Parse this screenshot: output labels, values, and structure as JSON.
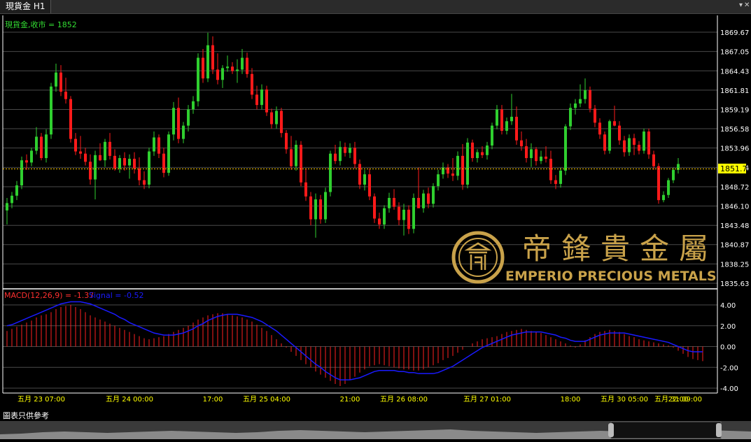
{
  "tab": {
    "title": "現貨金 H1"
  },
  "main_chart": {
    "series_label": "現貨金,收市 = 1852",
    "current_price": "1851.77",
    "price_ticks": [
      "1869.67",
      "1867.05",
      "1864.43",
      "1861.81",
      "1859.19",
      "1856.58",
      "1853.96",
      "1851.34",
      "1848.72",
      "1846.10",
      "1843.48",
      "1840.87",
      "1838.25",
      "1835.63"
    ]
  },
  "macd": {
    "label_macd": "MACD(12,26,9) = -1.37",
    "label_signal": "Signal = -0.52",
    "ticks": [
      "4.00",
      "2.00",
      "0.00",
      "-2.00",
      "-4.00"
    ]
  },
  "time_axis": [
    "五月 23 07:00",
    "五月 24 00:00",
    "17:00",
    "五月 25 04:00",
    "21:00",
    "五月 26 08:00",
    "五月 27 01:00",
    "18:00",
    "五月 30 05:00",
    "22:00",
    "五月 31 09:00"
  ],
  "watermark": {
    "chinese": "帝鋒貴金屬",
    "english": "EMPERIO PRECIOUS METALS"
  },
  "footer": {
    "note": "圖表只供參考"
  },
  "colors": {
    "up": "#2fcf2f",
    "down": "#ff1a1a",
    "macd_hist": "#ff2020",
    "signal": "#1a1aff",
    "grid": "#4a4a4a",
    "axis_text": "#ffffff",
    "time_text": "#ffff00",
    "label_green": "#33dd33",
    "price_line": "#ffcc00",
    "gold": "#c9a24a"
  },
  "chart_data": {
    "type": "candlestick",
    "title": "現貨金 H1",
    "timeframe": "H1",
    "ylim": [
      1835.63,
      1870.9
    ],
    "macd_ylim": [
      -4.0,
      5.0
    ],
    "grid": true,
    "x_tick_labels": [
      "五月 23 07:00",
      "五月 24 00:00",
      "17:00",
      "五月 25 04:00",
      "21:00",
      "五月 26 08:00",
      "五月 27 01:00",
      "18:00",
      "五月 30 05:00",
      "22:00",
      "五月 31 09:00"
    ],
    "ohlc": [
      [
        1845.5,
        1847.2,
        1843.6,
        1846.5
      ],
      [
        1846.5,
        1848.0,
        1845.8,
        1847.5
      ],
      [
        1847.5,
        1849.5,
        1846.9,
        1848.9
      ],
      [
        1848.9,
        1852.8,
        1848.4,
        1852.3
      ],
      [
        1852.3,
        1853.1,
        1851.0,
        1852.0
      ],
      [
        1852.0,
        1854.0,
        1851.5,
        1853.6
      ],
      [
        1853.6,
        1856.8,
        1853.1,
        1855.5
      ],
      [
        1855.5,
        1856.0,
        1852.3,
        1852.6
      ],
      [
        1852.6,
        1856.5,
        1852.0,
        1855.8
      ],
      [
        1855.8,
        1862.8,
        1855.2,
        1862.3
      ],
      [
        1862.3,
        1865.4,
        1861.6,
        1864.2
      ],
      [
        1864.2,
        1865.2,
        1861.0,
        1861.6
      ],
      [
        1861.6,
        1863.5,
        1860.0,
        1860.6
      ],
      [
        1860.6,
        1861.0,
        1854.7,
        1855.2
      ],
      [
        1855.2,
        1856.0,
        1853.0,
        1853.5
      ],
      [
        1853.5,
        1855.6,
        1852.5,
        1853.2
      ],
      [
        1853.2,
        1854.0,
        1851.6,
        1852.1
      ],
      [
        1852.1,
        1853.1,
        1849.0,
        1849.7
      ],
      [
        1849.7,
        1853.6,
        1847.0,
        1853.0
      ],
      [
        1853.0,
        1854.6,
        1852.2,
        1852.3
      ],
      [
        1852.3,
        1855.2,
        1851.4,
        1854.8
      ],
      [
        1854.8,
        1856.0,
        1852.4,
        1852.9
      ],
      [
        1852.9,
        1853.8,
        1850.9,
        1851.2
      ],
      [
        1851.2,
        1853.0,
        1850.6,
        1852.6
      ],
      [
        1852.6,
        1853.4,
        1850.9,
        1851.6
      ],
      [
        1851.6,
        1853.1,
        1849.8,
        1852.5
      ],
      [
        1852.5,
        1853.4,
        1850.5,
        1851.2
      ],
      [
        1851.2,
        1852.7,
        1848.9,
        1849.6
      ],
      [
        1849.6,
        1850.8,
        1848.4,
        1849.0
      ],
      [
        1849.0,
        1854.0,
        1848.5,
        1853.5
      ],
      [
        1853.5,
        1856.2,
        1852.9,
        1855.4
      ],
      [
        1855.4,
        1855.8,
        1852.6,
        1853.2
      ],
      [
        1853.2,
        1854.0,
        1850.0,
        1850.6
      ],
      [
        1850.6,
        1856.2,
        1850.2,
        1855.8
      ],
      [
        1855.8,
        1860.2,
        1855.0,
        1859.4
      ],
      [
        1859.4,
        1860.8,
        1854.6,
        1855.2
      ],
      [
        1855.2,
        1857.5,
        1854.6,
        1857.0
      ],
      [
        1857.0,
        1859.8,
        1856.2,
        1859.2
      ],
      [
        1859.2,
        1861.0,
        1858.6,
        1860.3
      ],
      [
        1860.3,
        1866.8,
        1859.6,
        1866.2
      ],
      [
        1866.2,
        1867.4,
        1862.8,
        1863.4
      ],
      [
        1863.4,
        1869.6,
        1862.9,
        1867.9
      ],
      [
        1867.9,
        1869.1,
        1864.0,
        1864.6
      ],
      [
        1864.6,
        1866.8,
        1862.6,
        1863.2
      ],
      [
        1863.2,
        1865.2,
        1862.1,
        1864.8
      ],
      [
        1864.8,
        1866.5,
        1864.3,
        1865.0
      ],
      [
        1865.0,
        1865.6,
        1864.0,
        1864.4
      ],
      [
        1864.4,
        1866.0,
        1862.8,
        1864.6
      ],
      [
        1864.6,
        1867.4,
        1864.0,
        1866.2
      ],
      [
        1866.2,
        1866.9,
        1863.5,
        1864.0
      ],
      [
        1864.0,
        1864.8,
        1860.6,
        1861.2
      ],
      [
        1861.2,
        1862.4,
        1859.2,
        1859.8
      ],
      [
        1859.8,
        1862.6,
        1859.2,
        1861.9
      ],
      [
        1861.9,
        1862.4,
        1858.3,
        1858.8
      ],
      [
        1858.8,
        1859.3,
        1856.6,
        1857.2
      ],
      [
        1857.2,
        1859.6,
        1856.6,
        1859.0
      ],
      [
        1859.0,
        1859.4,
        1855.4,
        1856.0
      ],
      [
        1856.0,
        1856.4,
        1853.2,
        1853.8
      ],
      [
        1853.8,
        1855.6,
        1851.0,
        1851.5
      ],
      [
        1851.5,
        1855.0,
        1850.9,
        1854.4
      ],
      [
        1854.4,
        1854.9,
        1848.8,
        1849.3
      ],
      [
        1849.3,
        1851.2,
        1846.8,
        1847.4
      ],
      [
        1847.4,
        1848.0,
        1843.5,
        1844.3
      ],
      [
        1844.3,
        1847.8,
        1841.8,
        1847.0
      ],
      [
        1847.0,
        1847.6,
        1843.7,
        1844.3
      ],
      [
        1844.3,
        1848.6,
        1843.8,
        1848.0
      ],
      [
        1848.0,
        1853.6,
        1847.4,
        1853.2
      ],
      [
        1853.2,
        1854.4,
        1851.8,
        1852.2
      ],
      [
        1852.2,
        1854.9,
        1851.6,
        1854.1
      ],
      [
        1854.1,
        1854.7,
        1852.8,
        1853.3
      ],
      [
        1853.3,
        1854.6,
        1852.6,
        1854.0
      ],
      [
        1854.0,
        1854.8,
        1851.2,
        1851.8
      ],
      [
        1851.8,
        1852.4,
        1848.4,
        1849.0
      ],
      [
        1849.0,
        1851.0,
        1848.2,
        1850.4
      ],
      [
        1850.4,
        1851.2,
        1846.9,
        1847.4
      ],
      [
        1847.4,
        1847.8,
        1843.8,
        1844.4
      ],
      [
        1844.4,
        1845.2,
        1843.0,
        1843.6
      ],
      [
        1843.6,
        1846.2,
        1843.0,
        1845.8
      ],
      [
        1845.8,
        1847.9,
        1845.2,
        1847.2
      ],
      [
        1847.2,
        1848.4,
        1845.6,
        1846.0
      ],
      [
        1846.0,
        1846.6,
        1843.5,
        1844.2
      ],
      [
        1844.2,
        1846.4,
        1842.1,
        1845.6
      ],
      [
        1845.6,
        1846.2,
        1842.3,
        1843.0
      ],
      [
        1843.0,
        1847.8,
        1842.4,
        1847.2
      ],
      [
        1847.2,
        1851.3,
        1846.7,
        1845.8
      ],
      [
        1845.8,
        1848.3,
        1845.2,
        1847.8
      ],
      [
        1847.8,
        1848.6,
        1845.8,
        1846.4
      ],
      [
        1846.4,
        1849.2,
        1845.9,
        1848.8
      ],
      [
        1848.8,
        1851.0,
        1848.2,
        1850.4
      ],
      [
        1850.4,
        1852.0,
        1849.8,
        1851.3
      ],
      [
        1851.3,
        1851.8,
        1849.9,
        1850.5
      ],
      [
        1850.5,
        1852.6,
        1849.5,
        1850.2
      ],
      [
        1850.2,
        1853.5,
        1849.6,
        1852.9
      ],
      [
        1852.9,
        1854.5,
        1848.3,
        1849.0
      ],
      [
        1849.0,
        1855.3,
        1848.5,
        1854.7
      ],
      [
        1854.7,
        1855.1,
        1852.1,
        1852.6
      ],
      [
        1852.6,
        1853.8,
        1852.0,
        1853.4
      ],
      [
        1853.4,
        1854.2,
        1852.6,
        1853.0
      ],
      [
        1853.0,
        1854.8,
        1852.4,
        1854.3
      ],
      [
        1854.3,
        1857.4,
        1853.8,
        1857.0
      ],
      [
        1857.0,
        1859.8,
        1856.5,
        1859.2
      ],
      [
        1859.2,
        1859.8,
        1855.8,
        1856.3
      ],
      [
        1856.3,
        1858.1,
        1855.8,
        1857.6
      ],
      [
        1857.6,
        1861.3,
        1857.1,
        1858.2
      ],
      [
        1858.2,
        1859.6,
        1854.4,
        1855.0
      ],
      [
        1855.0,
        1856.2,
        1853.6,
        1854.2
      ],
      [
        1854.2,
        1855.2,
        1852.0,
        1852.6
      ],
      [
        1852.6,
        1854.6,
        1851.4,
        1853.8
      ],
      [
        1853.8,
        1854.1,
        1851.6,
        1852.2
      ],
      [
        1852.2,
        1853.6,
        1851.8,
        1852.8
      ],
      [
        1852.8,
        1854.2,
        1852.0,
        1852.5
      ],
      [
        1852.5,
        1853.6,
        1849.1,
        1849.6
      ],
      [
        1849.6,
        1850.3,
        1848.4,
        1849.1
      ],
      [
        1849.1,
        1851.3,
        1848.6,
        1850.9
      ],
      [
        1850.9,
        1857.2,
        1850.3,
        1856.9
      ],
      [
        1856.9,
        1860.0,
        1856.4,
        1859.4
      ],
      [
        1859.4,
        1860.6,
        1858.5,
        1860.0
      ],
      [
        1860.0,
        1862.6,
        1859.5,
        1860.6
      ],
      [
        1860.6,
        1863.4,
        1860.0,
        1861.8
      ],
      [
        1861.8,
        1862.3,
        1858.8,
        1859.3
      ],
      [
        1859.3,
        1859.8,
        1856.8,
        1857.4
      ],
      [
        1857.4,
        1858.0,
        1855.2,
        1855.8
      ],
      [
        1855.8,
        1856.2,
        1853.1,
        1853.6
      ],
      [
        1853.6,
        1857.8,
        1853.2,
        1857.6
      ],
      [
        1857.6,
        1859.7,
        1856.9,
        1857.0
      ],
      [
        1857.0,
        1857.6,
        1854.4,
        1855.0
      ],
      [
        1855.0,
        1855.6,
        1852.8,
        1853.4
      ],
      [
        1853.4,
        1855.8,
        1852.9,
        1855.3
      ],
      [
        1855.3,
        1855.9,
        1853.0,
        1854.4
      ],
      [
        1854.4,
        1854.9,
        1853.1,
        1853.6
      ],
      [
        1853.6,
        1856.6,
        1853.2,
        1856.2
      ],
      [
        1856.2,
        1856.6,
        1852.5,
        1853.1
      ],
      [
        1853.1,
        1853.6,
        1851.0,
        1851.5
      ],
      [
        1851.5,
        1851.9,
        1846.4,
        1846.9
      ],
      [
        1846.9,
        1848.1,
        1846.6,
        1847.6
      ],
      [
        1847.6,
        1849.9,
        1847.2,
        1849.6
      ],
      [
        1849.6,
        1851.3,
        1849.2,
        1851.0
      ],
      [
        1851.0,
        1852.6,
        1850.5,
        1851.8
      ]
    ],
    "macd_histogram": [
      1.5,
      1.7,
      1.9,
      2.1,
      2.3,
      2.5,
      2.8,
      3.0,
      3.1,
      3.3,
      3.6,
      3.8,
      3.9,
      4.0,
      3.8,
      3.6,
      3.3,
      3.0,
      2.8,
      2.6,
      2.4,
      2.2,
      2.0,
      1.8,
      1.6,
      1.4,
      1.2,
      1.0,
      0.8,
      0.7,
      0.8,
      0.9,
      1.0,
      1.2,
      1.4,
      1.6,
      1.8,
      2.0,
      2.3,
      2.6,
      2.8,
      3.0,
      3.1,
      3.2,
      3.2,
      3.1,
      3.0,
      2.9,
      2.8,
      2.6,
      2.4,
      2.1,
      1.8,
      1.5,
      1.1,
      0.7,
      0.3,
      -0.1,
      -0.5,
      -0.9,
      -1.3,
      -1.7,
      -2.0,
      -2.4,
      -2.7,
      -3.0,
      -3.3,
      -3.6,
      -3.8,
      -3.6,
      -3.2,
      -2.9,
      -2.5,
      -2.2,
      -1.9,
      -1.8,
      -1.7,
      -1.8,
      -1.9,
      -2.0,
      -2.1,
      -2.2,
      -2.2,
      -2.3,
      -2.3,
      -2.2,
      -2.0,
      -1.8,
      -1.6,
      -1.3,
      -1.1,
      -0.9,
      -0.6,
      -0.3,
      0.0,
      0.3,
      0.5,
      0.7,
      0.8,
      0.9,
      1.0,
      1.2,
      1.4,
      1.5,
      1.6,
      1.7,
      1.6,
      1.5,
      1.4,
      1.3,
      1.1,
      0.9,
      0.7,
      0.5,
      0.3,
      0.1,
      -0.1,
      0.2,
      0.6,
      0.9,
      1.2,
      1.4,
      1.5,
      1.6,
      1.5,
      1.4,
      1.2,
      1.0,
      0.9,
      0.7,
      0.6,
      0.5,
      0.4,
      0.3,
      0.2,
      0.1,
      -0.1,
      -0.4,
      -0.7,
      -1.0,
      -1.2,
      -1.3,
      -1.4
    ],
    "signal": [
      2.0,
      2.1,
      2.3,
      2.5,
      2.7,
      2.9,
      3.1,
      3.3,
      3.5,
      3.7,
      3.9,
      4.1,
      4.2,
      4.3,
      4.3,
      4.3,
      4.2,
      4.1,
      3.9,
      3.7,
      3.5,
      3.3,
      3.1,
      2.8,
      2.6,
      2.3,
      2.1,
      1.9,
      1.7,
      1.5,
      1.3,
      1.2,
      1.1,
      1.1,
      1.1,
      1.2,
      1.3,
      1.5,
      1.7,
      2.0,
      2.2,
      2.5,
      2.7,
      2.9,
      3.0,
      3.1,
      3.1,
      3.1,
      3.0,
      2.9,
      2.8,
      2.6,
      2.4,
      2.1,
      1.8,
      1.5,
      1.1,
      0.7,
      0.3,
      -0.1,
      -0.5,
      -0.9,
      -1.3,
      -1.7,
      -2.0,
      -2.4,
      -2.7,
      -3.0,
      -3.2,
      -3.2,
      -3.2,
      -3.1,
      -3.0,
      -2.8,
      -2.6,
      -2.4,
      -2.3,
      -2.3,
      -2.3,
      -2.3,
      -2.4,
      -2.4,
      -2.5,
      -2.5,
      -2.6,
      -2.6,
      -2.6,
      -2.6,
      -2.5,
      -2.3,
      -2.1,
      -1.9,
      -1.6,
      -1.3,
      -1.0,
      -0.7,
      -0.4,
      -0.1,
      0.1,
      0.3,
      0.5,
      0.7,
      0.9,
      1.1,
      1.2,
      1.3,
      1.4,
      1.4,
      1.4,
      1.4,
      1.3,
      1.2,
      1.1,
      0.9,
      0.8,
      0.6,
      0.5,
      0.5,
      0.5,
      0.7,
      0.9,
      1.1,
      1.2,
      1.3,
      1.3,
      1.3,
      1.3,
      1.2,
      1.1,
      1.0,
      0.9,
      0.8,
      0.7,
      0.6,
      0.5,
      0.4,
      0.2,
      0.0,
      -0.2,
      -0.4,
      -0.5,
      -0.5,
      -0.5
    ],
    "navigator_profile": [
      0.35,
      0.4,
      0.5,
      0.55,
      0.5,
      0.45,
      0.5,
      0.55,
      0.6,
      0.55,
      0.5,
      0.45,
      0.5,
      0.6,
      0.65,
      0.6,
      0.55,
      0.5,
      0.55,
      0.6,
      0.65,
      0.7,
      0.6,
      0.55,
      0.5,
      0.45,
      0.5,
      0.55,
      0.6,
      0.55,
      0.5,
      0.55,
      0.6,
      0.65,
      0.6,
      0.55
    ]
  }
}
